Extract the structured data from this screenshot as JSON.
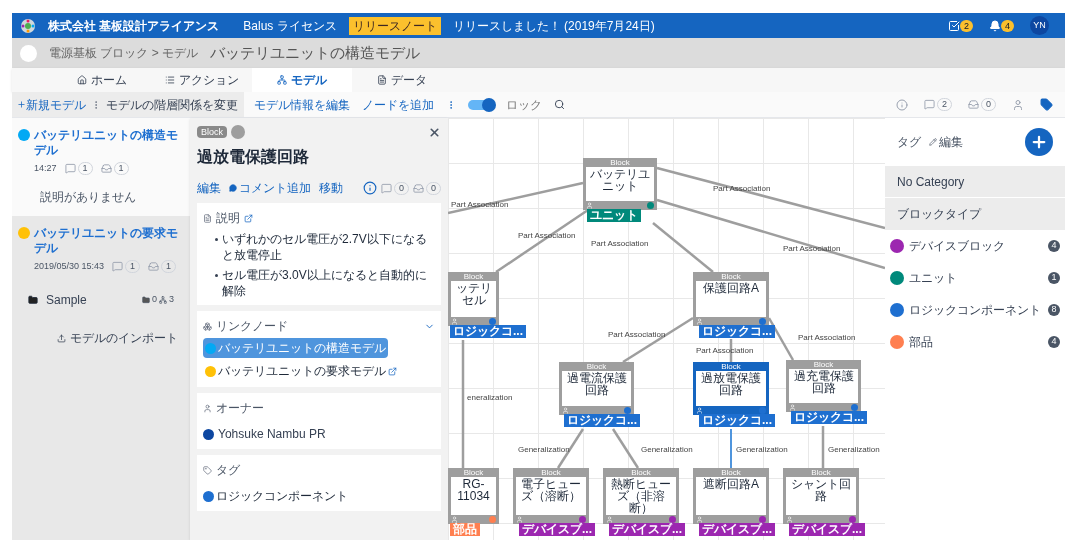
{
  "header": {
    "company": "株式会社 基板設計アライアンス",
    "license": "Balus ライセンス",
    "release_badge": "リリースノート",
    "release_text": "リリースしました！ (2019年7月24日)",
    "tasks_count": "2",
    "notifications_count": "4",
    "avatar": "YN"
  },
  "breadcrumb": {
    "path": "電源基板 ブロック > モデル",
    "title": "バッテリユニットの構造モデル"
  },
  "nav_tabs": [
    {
      "label": "ホーム",
      "kind": "home",
      "selected": false
    },
    {
      "label": "アクション",
      "kind": "action",
      "selected": false
    },
    {
      "label": "モデル",
      "kind": "model",
      "selected": true
    },
    {
      "label": "データ",
      "kind": "data",
      "selected": false
    }
  ],
  "toolbar": {
    "new_model": "新規モデル",
    "change_hierarchy": "モデルの階層関係を変更",
    "edit_model": "モデル情報を編集",
    "add_node": "ノードを追加",
    "lock": {
      "label": "ロック",
      "on": true
    },
    "comments_count": "2",
    "boxes_count": "0"
  },
  "sidebar": {
    "models": [
      {
        "title": "バッテリユニットの構造モデル",
        "color": "#03a9f4",
        "time": "14:27",
        "comments": "1",
        "boxes": "1",
        "description": "説明がありません",
        "selected": true
      },
      {
        "title": "バッテリユニットの要求モデル",
        "color": "#ffc107",
        "time": "2019/05/30 15:43",
        "comments": "1",
        "boxes": "1",
        "selected": false
      }
    ],
    "folder": {
      "name": "Sample",
      "folders": "0",
      "models": "3"
    },
    "import_label": "モデルのインポート"
  },
  "detail": {
    "type": "Block",
    "title": "過放電保護回路",
    "actions": [
      "編集",
      "コメント追加",
      "移動"
    ],
    "comments_count": "0",
    "boxes_count": "0",
    "description_label": "説明",
    "description": [
      "いずれかのセル電圧が2.7V以下になると放電停止",
      "セル電圧が3.0V以上になると自動的に解除"
    ],
    "linked_label": "リンクノード",
    "linked_nodes": [
      {
        "title": "バッテリユニットの構造モデル",
        "color": "#03a9f4",
        "selected": true
      },
      {
        "title": "バッテリユニットの要求モデル",
        "color": "#ffc107",
        "selected": false
      }
    ],
    "owner_label": "オーナー",
    "owner": "Yohsuke Nambu PR",
    "tags_label": "タグ",
    "tags": [
      {
        "label": "ロジックコンポーネント",
        "color": "#1e6fd0"
      }
    ]
  },
  "canvas": {
    "nodes": [
      {
        "stereotype": "Block",
        "title": "バッテリユニット",
        "selected": false,
        "tag": {
          "label": "ユニット",
          "color": "#00897b"
        }
      },
      {
        "stereotype": "Block",
        "title": "ッテリセル",
        "selected": false,
        "tag": {
          "label": "ロジックコ...",
          "color": "#1e6fd0"
        }
      },
      {
        "stereotype": "Block",
        "title": "保護回路A",
        "selected": false,
        "tag": {
          "label": "ロジックコ...",
          "color": "#1e6fd0"
        }
      },
      {
        "stereotype": "Block",
        "title": "過電流保護回路",
        "selected": false,
        "tag": {
          "label": "ロジックコ...",
          "color": "#1e6fd0"
        }
      },
      {
        "stereotype": "Block",
        "title": "過放電保護回路",
        "selected": true,
        "tag": {
          "label": "ロジックコ...",
          "color": "#1e6fd0"
        }
      },
      {
        "stereotype": "Block",
        "title": "過充電保護回路",
        "selected": false,
        "tag": {
          "label": "ロジックコ...",
          "color": "#1e6fd0"
        }
      },
      {
        "stereotype": "Block",
        "title": "RG-11034",
        "selected": false,
        "tag": {
          "label": "部品",
          "color": "#ff7f50"
        }
      },
      {
        "stereotype": "Block",
        "title": "電子ヒューズ（溶断）",
        "selected": false,
        "tag": {
          "label": "デバイスブ...",
          "color": "#9c27b0"
        }
      },
      {
        "stereotype": "Block",
        "title": "熱断ヒューズ（非溶断）",
        "selected": false,
        "tag": {
          "label": "デバイスブ...",
          "color": "#9c27b0"
        }
      },
      {
        "stereotype": "Block",
        "title": "遮断回路A",
        "selected": false,
        "tag": {
          "label": "デバイスブ...",
          "color": "#9c27b0"
        }
      },
      {
        "stereotype": "Block",
        "title": "シャント回路",
        "selected": false,
        "tag": {
          "label": "デバイスブ...",
          "color": "#9c27b0"
        }
      }
    ],
    "edges": [
      {
        "label": "Part Association",
        "highlighted": false
      },
      {
        "label": "Part Association",
        "highlighted": false
      },
      {
        "label": "Part Association",
        "highlighted": false
      },
      {
        "label": "Part Association",
        "highlighted": false
      },
      {
        "label": "Part Association",
        "highlighted": false
      },
      {
        "label": "Part Association",
        "highlighted": false
      },
      {
        "label": "Part Association",
        "highlighted": false
      },
      {
        "label": "Part Association",
        "highlighted": false
      },
      {
        "label": "Generalization",
        "highlighted": false
      },
      {
        "label": "Generalization",
        "highlighted": false
      },
      {
        "label": "Generalization",
        "highlighted": true
      },
      {
        "label": "Generalization",
        "highlighted": false
      },
      {
        "label": "eneralization",
        "highlighted": false
      }
    ]
  },
  "tag_panel": {
    "title": "タグ",
    "edit": "編集",
    "no_category": "No Category",
    "group": "ブロックタイプ",
    "items": [
      {
        "label": "デバイスブロック",
        "color": "#9c27b0",
        "count": "4"
      },
      {
        "label": "ユニット",
        "color": "#00897b",
        "count": "1"
      },
      {
        "label": "ロジックコンポーネント",
        "color": "#1e6fd0",
        "count": "8"
      },
      {
        "label": "部品",
        "color": "#ff7f50",
        "count": "4"
      }
    ]
  }
}
